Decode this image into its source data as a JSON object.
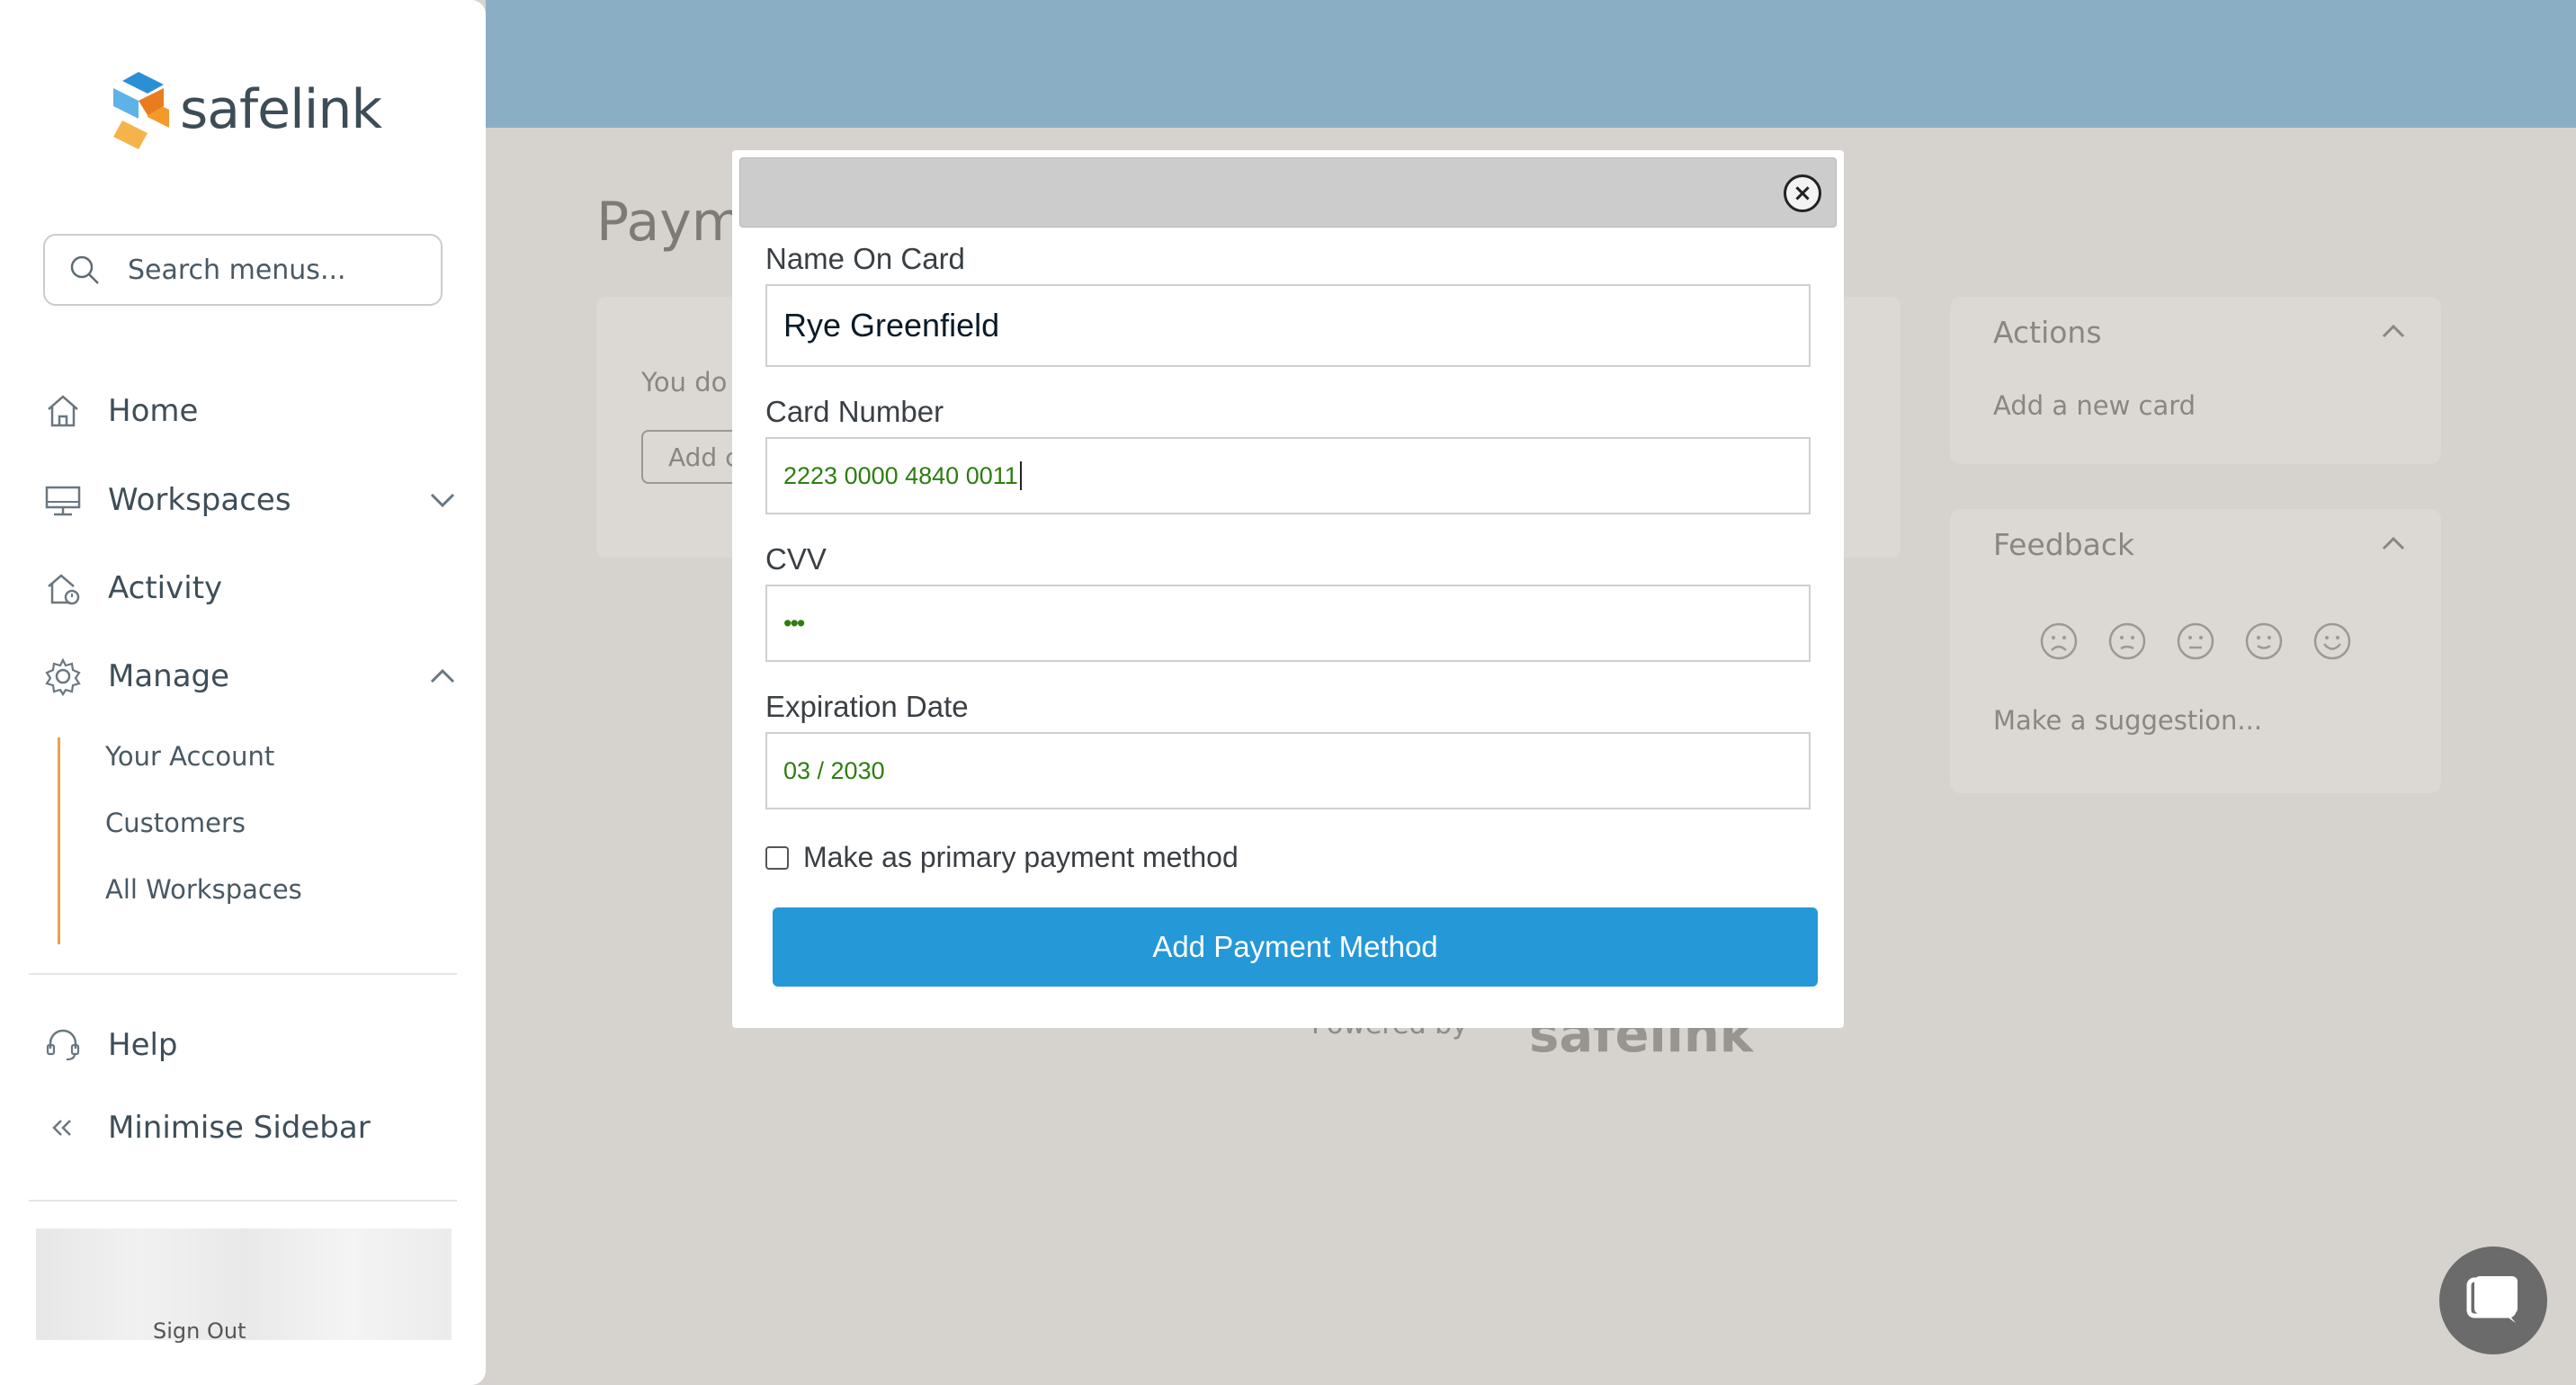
{
  "sidebar": {
    "logo_text": "safelink",
    "search_placeholder": "Search menus...",
    "items": [
      {
        "label": "Home",
        "icon": "home-icon"
      },
      {
        "label": "Workspaces",
        "icon": "monitor-icon"
      },
      {
        "label": "Activity",
        "icon": "activity-icon"
      },
      {
        "label": "Manage",
        "icon": "gear-icon"
      }
    ],
    "manage_sub": [
      "Your Account",
      "Customers",
      "All Workspaces"
    ],
    "help_label": "Help",
    "minimise_label": "Minimise Sidebar",
    "signout_label": "Sign Out"
  },
  "page": {
    "title_partial": "Paym",
    "card_text_partial": "You do",
    "card_button_partial": "Add c",
    "actions": {
      "title": "Actions",
      "link": "Add a new card"
    },
    "feedback": {
      "title": "Feedback",
      "link": "Make a suggestion..."
    },
    "powered_by": "Powered by",
    "powered_logo": "safelink"
  },
  "modal": {
    "name_label": "Name On Card",
    "name_value": "Rye Greenfield",
    "card_label": "Card Number",
    "card_value": "2223 0000 4840 0011",
    "cvv_label": "CVV",
    "cvv_value": "•••",
    "expiry_label": "Expiration Date",
    "expiry_value": "03 / 2030",
    "primary_label": "Make as primary payment method",
    "submit_label": "Add Payment Method",
    "close_glyph": "×"
  },
  "colors": {
    "accent": "#2598d8",
    "header": "#8aafc4",
    "brand_orange": "#e8a34a",
    "input_text": "#2e7d12"
  }
}
